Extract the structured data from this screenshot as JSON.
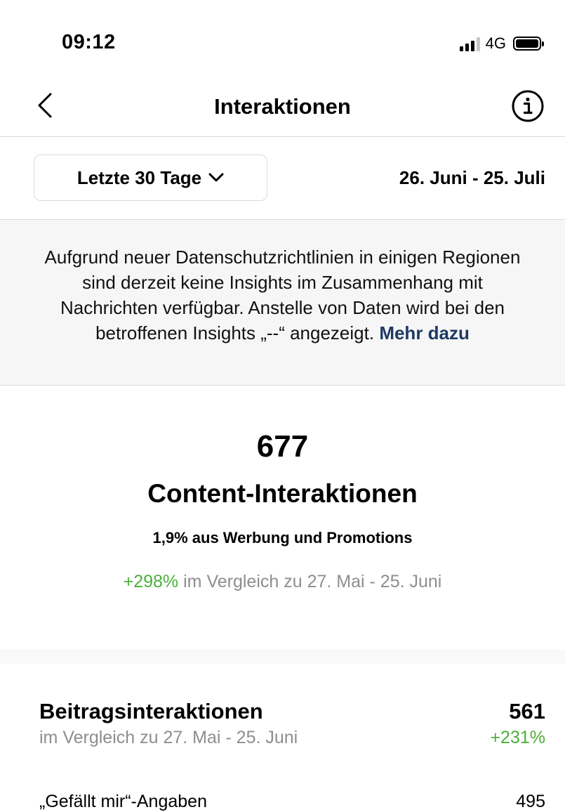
{
  "status_bar": {
    "time": "09:12",
    "network": "4G",
    "icons": [
      "signal-icon",
      "battery-icon"
    ]
  },
  "nav": {
    "back_icon": "chevron-left-icon",
    "title": "Interaktionen",
    "info_icon": "info-icon"
  },
  "filter": {
    "range_label": "Letzte 30 Tage",
    "range_chevron_icon": "chevron-down-icon",
    "date_range": "26. Juni - 25. Juli"
  },
  "notice": {
    "text": "Aufgrund neuer Datenschutzrichtlinien in einigen Regionen sind derzeit keine Insights im Zusammenhang mit Nachrichten verfügbar. Anstelle von Daten wird bei den betroffenen Insights „--“ angezeigt.",
    "link": "Mehr dazu"
  },
  "summary": {
    "total": "677",
    "label": "Content-Interaktionen",
    "ads_share": "1,9% aus Werbung und Promotions",
    "change": "+298%",
    "compare_text": "im Vergleich zu 27. Mai - 25. Juni"
  },
  "post_interactions": {
    "title": "Beitragsinteraktionen",
    "value": "561",
    "subtitle": "im Vergleich zu 27. Mai - 25. Juni",
    "change": "+231%",
    "rows": [
      {
        "label": "„Gefällt mir“-Angaben",
        "value": "495"
      }
    ]
  },
  "colors": {
    "accent_green": "#4caf3a",
    "link_blue": "#1e3a64",
    "muted_text": "#8e8e8e",
    "notice_bg": "#f6f6f6"
  }
}
